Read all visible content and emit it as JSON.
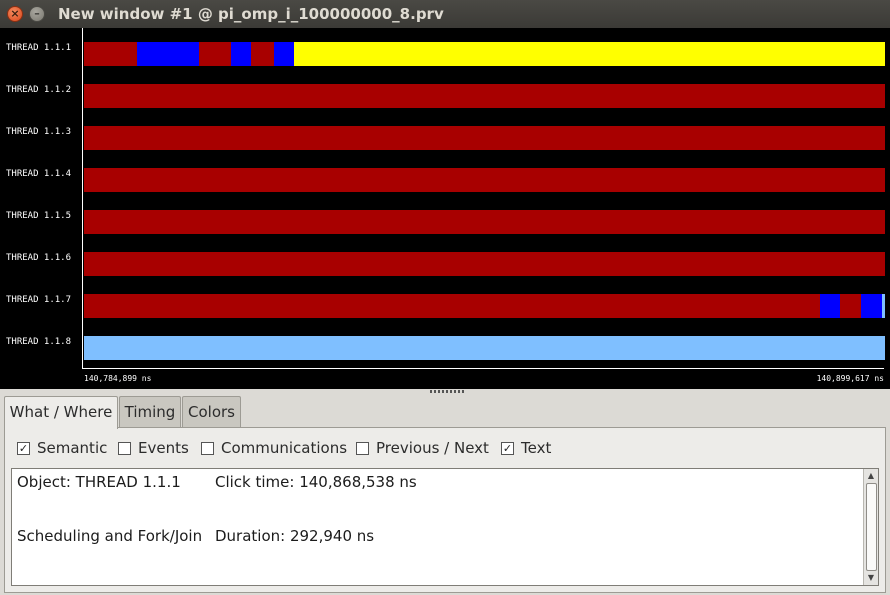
{
  "window": {
    "title": "New window #1 @ pi_omp_i_100000000_8.prv",
    "close_glyph": "×",
    "minimize_glyph": "–"
  },
  "colors": {
    "running": "#a80000",
    "sched_fork_join": "#0000ff",
    "yellow_state": "#ffff00",
    "light_blue_state": "#7fbfff",
    "background": "#000000"
  },
  "timeline": {
    "threads": [
      {
        "label": "THREAD 1.1.1",
        "segments": [
          {
            "start": 0,
            "end": 0.066,
            "color": "#a80000"
          },
          {
            "start": 0.066,
            "end": 0.143,
            "color": "#0000ff"
          },
          {
            "start": 0.143,
            "end": 0.184,
            "color": "#a80000"
          },
          {
            "start": 0.184,
            "end": 0.208,
            "color": "#0000ff"
          },
          {
            "start": 0.208,
            "end": 0.237,
            "color": "#a80000"
          },
          {
            "start": 0.237,
            "end": 0.262,
            "color": "#0000ff"
          },
          {
            "start": 0.262,
            "end": 1.0,
            "color": "#ffff00"
          }
        ]
      },
      {
        "label": "THREAD 1.1.2",
        "segments": [
          {
            "start": 0,
            "end": 1.0,
            "color": "#a80000"
          }
        ]
      },
      {
        "label": "THREAD 1.1.3",
        "segments": [
          {
            "start": 0,
            "end": 1.0,
            "color": "#a80000"
          }
        ]
      },
      {
        "label": "THREAD 1.1.4",
        "segments": [
          {
            "start": 0,
            "end": 1.0,
            "color": "#a80000"
          }
        ]
      },
      {
        "label": "THREAD 1.1.5",
        "segments": [
          {
            "start": 0,
            "end": 1.0,
            "color": "#a80000"
          }
        ]
      },
      {
        "label": "THREAD 1.1.6",
        "segments": [
          {
            "start": 0,
            "end": 1.0,
            "color": "#a80000"
          }
        ]
      },
      {
        "label": "THREAD 1.1.7",
        "segments": [
          {
            "start": 0,
            "end": 0.919,
            "color": "#a80000"
          },
          {
            "start": 0.919,
            "end": 0.944,
            "color": "#0000ff"
          },
          {
            "start": 0.944,
            "end": 0.97,
            "color": "#a80000"
          },
          {
            "start": 0.97,
            "end": 0.996,
            "color": "#0000ff"
          },
          {
            "start": 0.996,
            "end": 1.0,
            "color": "#7fbfff"
          }
        ]
      },
      {
        "label": "THREAD 1.1.8",
        "segments": [
          {
            "start": 0,
            "end": 1.0,
            "color": "#7fbfff"
          }
        ]
      }
    ],
    "start_time": "140,784,899 ns",
    "end_time": "140,899,617 ns"
  },
  "tabs": [
    {
      "label": "What / Where",
      "active": true
    },
    {
      "label": "Timing",
      "active": false
    },
    {
      "label": "Colors",
      "active": false
    }
  ],
  "options": [
    {
      "label": "Semantic",
      "checked": true
    },
    {
      "label": "Events",
      "checked": false
    },
    {
      "label": "Communications",
      "checked": false
    },
    {
      "label": "Previous / Next",
      "checked": false
    },
    {
      "label": "Text",
      "checked": true
    }
  ],
  "info": {
    "object": "Object: THREAD 1.1.1",
    "click_time": "Click time: 140,868,538 ns",
    "state": "Scheduling and Fork/Join",
    "duration": "Duration: 292,940 ns"
  },
  "scrollbar": {
    "up": "▲",
    "down": "▼"
  }
}
